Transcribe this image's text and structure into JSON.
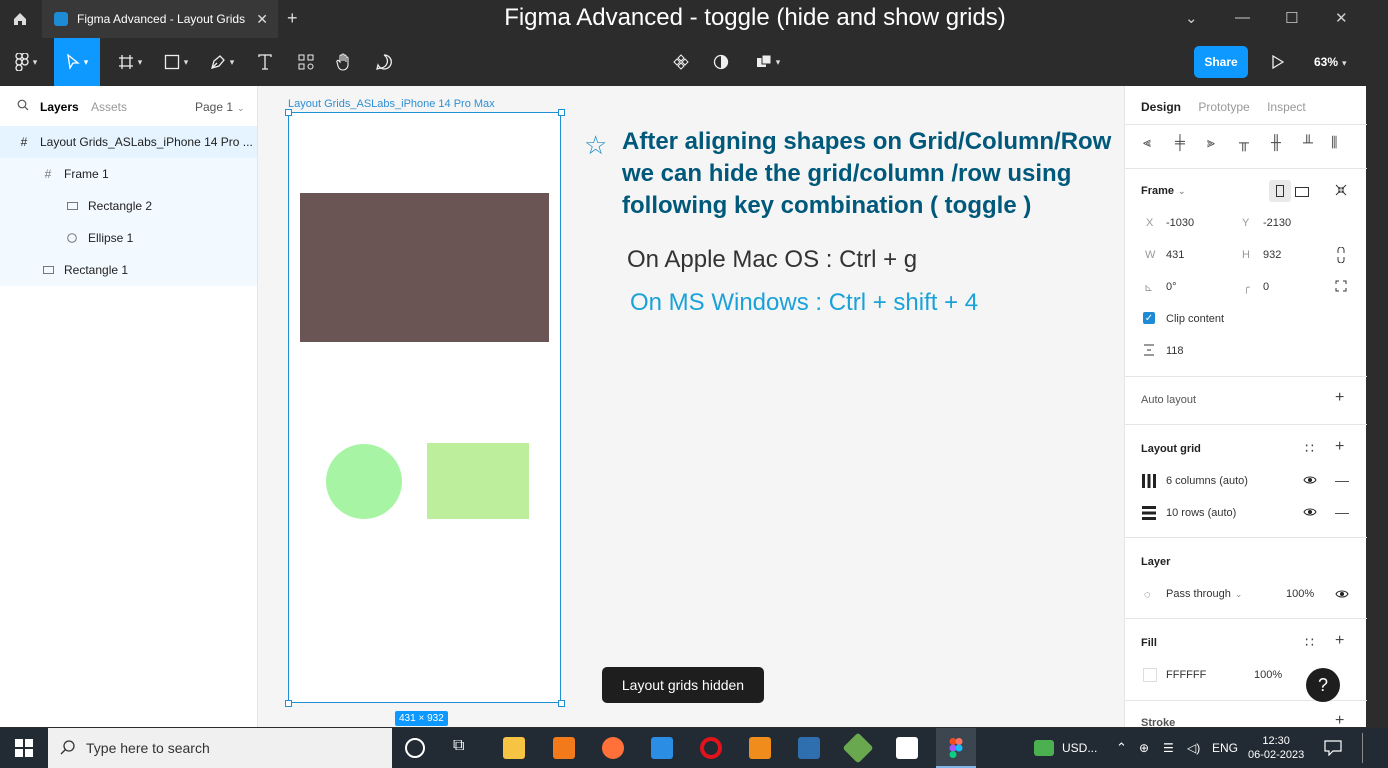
{
  "window": {
    "tab_title": "Figma Advanced - Layout Grids",
    "heading": "Figma Advanced - toggle (hide and show grids)"
  },
  "toolbar": {
    "share_label": "Share",
    "zoom": "63%"
  },
  "left_panel": {
    "tabs": [
      "Layers",
      "Assets"
    ],
    "page": "Page 1",
    "layers": [
      {
        "label": "Layout Grids_ASLabs_iPhone 14 Pro ...",
        "icon": "frame-icon"
      },
      {
        "label": "Frame 1",
        "icon": "frame-icon"
      },
      {
        "label": "Rectangle 2",
        "icon": "rectangle-icon"
      },
      {
        "label": "Ellipse 1",
        "icon": "ellipse-icon"
      },
      {
        "label": "Rectangle 1",
        "icon": "rectangle-icon"
      }
    ]
  },
  "canvas": {
    "frame_label": "Layout Grids_ASLabs_iPhone 14 Pro Max",
    "dims_label": "431 × 932",
    "note_line1": "After aligning shapes on Grid/Column/Row",
    "note_line2": "we can hide the grid/column /row using",
    "note_line3": "following key combination ( toggle )",
    "mac_shortcut": "On Apple Mac OS :  Ctrl + g",
    "win_shortcut": "On MS Windows :  Ctrl + shift + 4",
    "toast": "Layout grids hidden"
  },
  "right_panel": {
    "tabs": [
      "Design",
      "Prototype",
      "Inspect"
    ],
    "frame_title": "Frame",
    "x_label": "X",
    "x_value": "-1030",
    "y_label": "Y",
    "y_value": "-2130",
    "w_label": "W",
    "w_value": "431",
    "h_label": "H",
    "h_value": "932",
    "rotation": "0°",
    "radius": "0",
    "clip_content": "Clip content",
    "spacing": "118",
    "auto_layout": "Auto layout",
    "layout_grid": "Layout grid",
    "grid_columns": "6 columns (auto)",
    "grid_rows": "10 rows (auto)",
    "layer": "Layer",
    "blend": "Pass through",
    "layer_opacity": "100%",
    "fill": "Fill",
    "fill_hex": "FFFFFF",
    "fill_opacity": "100%",
    "stroke": "Stroke"
  },
  "taskbar": {
    "search_placeholder": "Type here to search",
    "currency": "USD...",
    "lang": "ENG",
    "time": "12:30",
    "date": "06-02-2023"
  },
  "colors": {
    "accent": "#0d99ff",
    "rect2": "#6b5454",
    "ellipse": "#a6f4a4",
    "rect1": "#bcee9c",
    "note": "#00587a",
    "win_shortcut": "#1aa2d8"
  }
}
